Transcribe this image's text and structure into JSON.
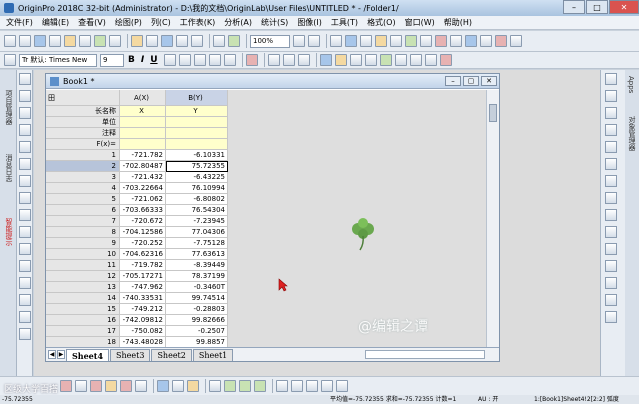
{
  "app": {
    "title": "OriginPro 2018C 32-bit (Administrator) - D:\\我的文档\\OriginLab\\User Files\\UNTITLED * - /Folder1/"
  },
  "menu": [
    "文件(F)",
    "编辑(E)",
    "查看(V)",
    "绘图(P)",
    "列(C)",
    "工作表(K)",
    "分析(A)",
    "统计(S)",
    "图像(I)",
    "工具(T)",
    "格式(O)",
    "窗口(W)",
    "帮助(H)"
  ],
  "toolbar": {
    "zoom": "100%",
    "font_prefix": "Tr 默认:",
    "font": "Times New",
    "font_size": "9",
    "bold": "B",
    "italic": "I",
    "underline": "U"
  },
  "left_panel": {
    "tab1": "项目管理器",
    "tab2": "消息日志",
    "tab3": "智能提示"
  },
  "right_panel": {
    "tab1": "Apps",
    "tab2": "对象管理器"
  },
  "book": {
    "title": "Book1 *",
    "corner": "田",
    "col_a": "A(X)",
    "col_b": "B(Y)",
    "meta_rows": [
      {
        "label": "长名称",
        "a": "X",
        "b": "Y"
      },
      {
        "label": "单位",
        "a": "",
        "b": ""
      },
      {
        "label": "注释",
        "a": "",
        "b": ""
      },
      {
        "label": "F(x)=",
        "a": "",
        "b": ""
      }
    ],
    "rows": [
      {
        "n": "1",
        "a": "-721.782",
        "b": "-6.10331"
      },
      {
        "n": "2",
        "a": "-702.80487",
        "b": "75.72355"
      },
      {
        "n": "3",
        "a": "-721.432",
        "b": "-6.43225"
      },
      {
        "n": "4",
        "a": "-703.22664",
        "b": "76.10994"
      },
      {
        "n": "5",
        "a": "-721.062",
        "b": "-6.80802"
      },
      {
        "n": "6",
        "a": "-703.66333",
        "b": "76.54304"
      },
      {
        "n": "7",
        "a": "-720.672",
        "b": "-7.23945"
      },
      {
        "n": "8",
        "a": "-704.12586",
        "b": "77.04306"
      },
      {
        "n": "9",
        "a": "-720.252",
        "b": "-7.75128"
      },
      {
        "n": "10",
        "a": "-704.62316",
        "b": "77.63613"
      },
      {
        "n": "11",
        "a": "-719.782",
        "b": "-8.39449"
      },
      {
        "n": "12",
        "a": "-705.17271",
        "b": "78.37199"
      },
      {
        "n": "13",
        "a": "-747.962",
        "b": "-0.3460T"
      },
      {
        "n": "14",
        "a": "-740.33531",
        "b": "99.74514"
      },
      {
        "n": "15",
        "a": "-749.212",
        "b": "-0.28803"
      },
      {
        "n": "16",
        "a": "-742.09812",
        "b": "99.82666"
      },
      {
        "n": "17",
        "a": "-750.082",
        "b": "-0.2507"
      },
      {
        "n": "18",
        "a": "-743.48028",
        "b": "99.8857"
      },
      {
        "n": "19",
        "a": "-751.342",
        "b": "-0.20114"
      }
    ],
    "tabs": [
      "Sheet4",
      "Sheet3",
      "Sheet2",
      "Sheet1"
    ],
    "active_tab": "Sheet4"
  },
  "watermark": "@编辑之谭",
  "status": {
    "left": "-75.72355",
    "middle": "平均值=-75.72355  求和=-75.72355  计数=1",
    "au": "AU : 开",
    "right": "1:[Book1]Sheet4!2[2:2]  弧度"
  },
  "bottom_logo": "区级大学百搭"
}
